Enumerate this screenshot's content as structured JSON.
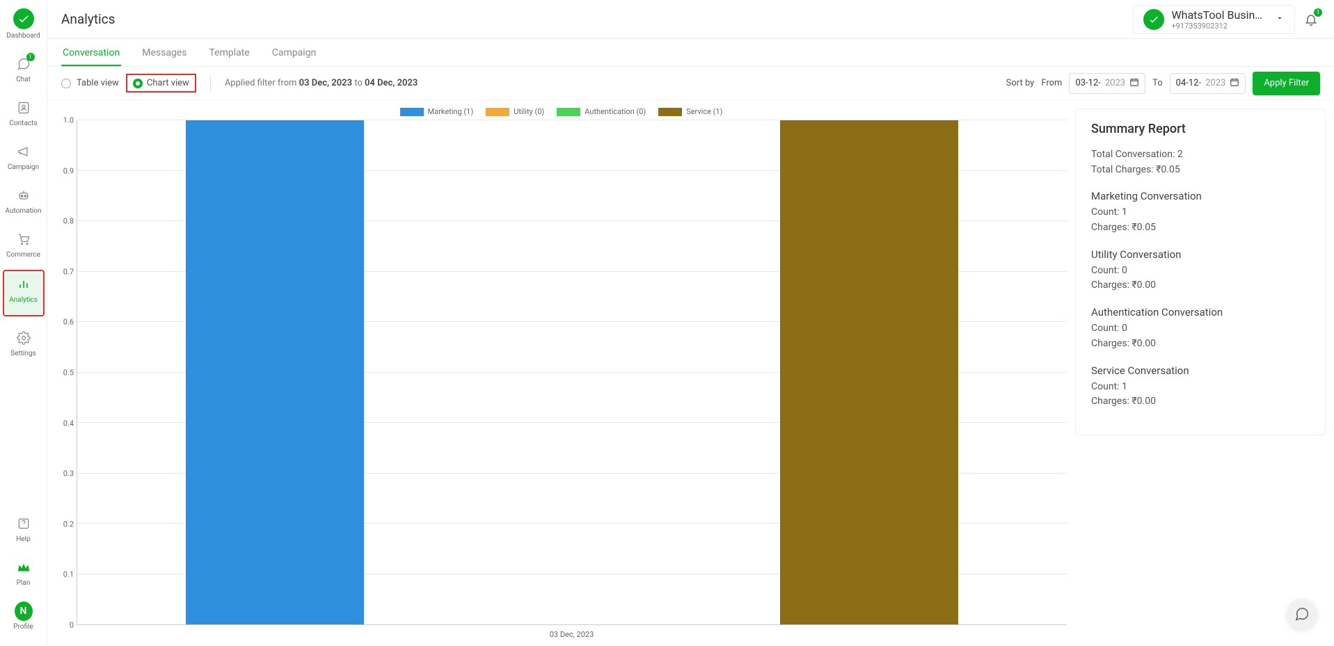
{
  "sidebar": {
    "items": [
      {
        "key": "dashboard",
        "label": "Dashboard"
      },
      {
        "key": "chat",
        "label": "Chat",
        "badge": "1"
      },
      {
        "key": "contacts",
        "label": "Contacts"
      },
      {
        "key": "campaign",
        "label": "Campaign"
      },
      {
        "key": "automation",
        "label": "Automation"
      },
      {
        "key": "commerce",
        "label": "Commerce"
      },
      {
        "key": "analytics",
        "label": "Analytics",
        "active": true,
        "highlighted": true
      },
      {
        "key": "settings",
        "label": "Settings"
      }
    ],
    "bottom": [
      {
        "key": "help",
        "label": "Help"
      },
      {
        "key": "plan",
        "label": "Plan"
      },
      {
        "key": "profile",
        "label": "Profile",
        "letter": "N"
      }
    ]
  },
  "topbar": {
    "title": "Analytics",
    "account_name": "WhatsTool Busin…",
    "account_phone": "+917353902312",
    "bell_badge": "1"
  },
  "tabs": [
    {
      "label": "Conversation",
      "active": true
    },
    {
      "label": "Messages"
    },
    {
      "label": "Template"
    },
    {
      "label": "Campaign"
    }
  ],
  "filter": {
    "table_label": "Table view",
    "chart_label": "Chart view",
    "applied_prefix": "Applied filter from ",
    "from_date": "03 Dec, 2023",
    "to_word": " to ",
    "to_date": "04 Dec, 2023",
    "sort_label": "Sort by",
    "from_label": "From",
    "to_label": "To",
    "from_input_solid": "03-12-",
    "from_input_faded": "2023",
    "to_input_solid": "04-12-",
    "to_input_faded": "2023",
    "apply_label": "Apply Filter"
  },
  "legend": {
    "marketing": "Marketing (1)",
    "utility": "Utility (0)",
    "authentication": "Authentication (0)",
    "service": "Service (1)"
  },
  "xaxis_label": "03 Dec, 2023",
  "yticks": [
    "0",
    "0.1",
    "0.2",
    "0.3",
    "0.4",
    "0.5",
    "0.6",
    "0.7",
    "0.8",
    "0.9",
    "1.0"
  ],
  "summary": {
    "title": "Summary Report",
    "total_conv": "Total Conversation: 2",
    "total_charges": "Total Charges: ₹0.05",
    "groups": [
      {
        "name": "Marketing Conversation",
        "count": "Count: 1",
        "charges": "Charges: ₹0.05"
      },
      {
        "name": "Utility Conversation",
        "count": "Count: 0",
        "charges": "Charges: ₹0.00"
      },
      {
        "name": "Authentication Conversation",
        "count": "Count: 0",
        "charges": "Charges: ₹0.00"
      },
      {
        "name": "Service Conversation",
        "count": "Count: 1",
        "charges": "Charges: ₹0.00"
      }
    ]
  },
  "chart_data": {
    "type": "bar",
    "categories": [
      "03 Dec, 2023"
    ],
    "series": [
      {
        "name": "Marketing",
        "color": "#2d8fdd",
        "values": [
          1
        ]
      },
      {
        "name": "Utility",
        "color": "#f2a83b",
        "values": [
          0
        ]
      },
      {
        "name": "Authentication",
        "color": "#4bd25a",
        "values": [
          0
        ]
      },
      {
        "name": "Service",
        "color": "#8a6d15",
        "values": [
          1
        ]
      }
    ],
    "ylim": [
      0,
      1.0
    ],
    "yticks": [
      0,
      0.1,
      0.2,
      0.3,
      0.4,
      0.5,
      0.6,
      0.7,
      0.8,
      0.9,
      1.0
    ],
    "xlabel": "",
    "ylabel": "",
    "title": ""
  }
}
